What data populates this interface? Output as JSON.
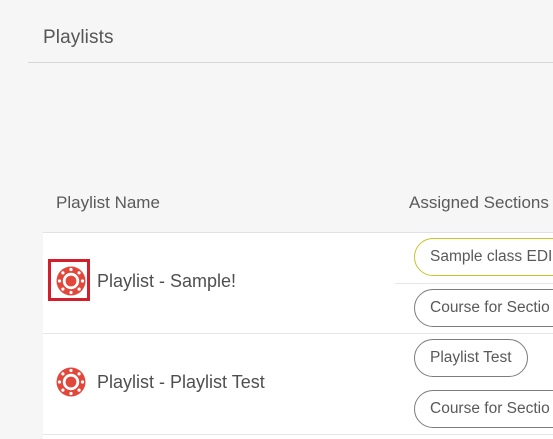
{
  "page": {
    "title": "Playlists"
  },
  "table": {
    "columns": [
      "Playlist Name",
      "Assigned Sections"
    ],
    "rows": [
      {
        "icon": "canvas-logo-icon",
        "name": "Playlist - Sample!",
        "sections": [
          "Sample class EDI",
          "Course for Sectio"
        ]
      },
      {
        "icon": "canvas-logo-icon",
        "name": "Playlist - Playlist Test",
        "sections": [
          "Playlist Test",
          "Course for Sectio"
        ]
      }
    ]
  },
  "colors": {
    "highlight": "#d21f2b",
    "icon": "#e2473b",
    "active_pill_border": "#c9c22d",
    "pill_border": "#7c7c7c"
  }
}
